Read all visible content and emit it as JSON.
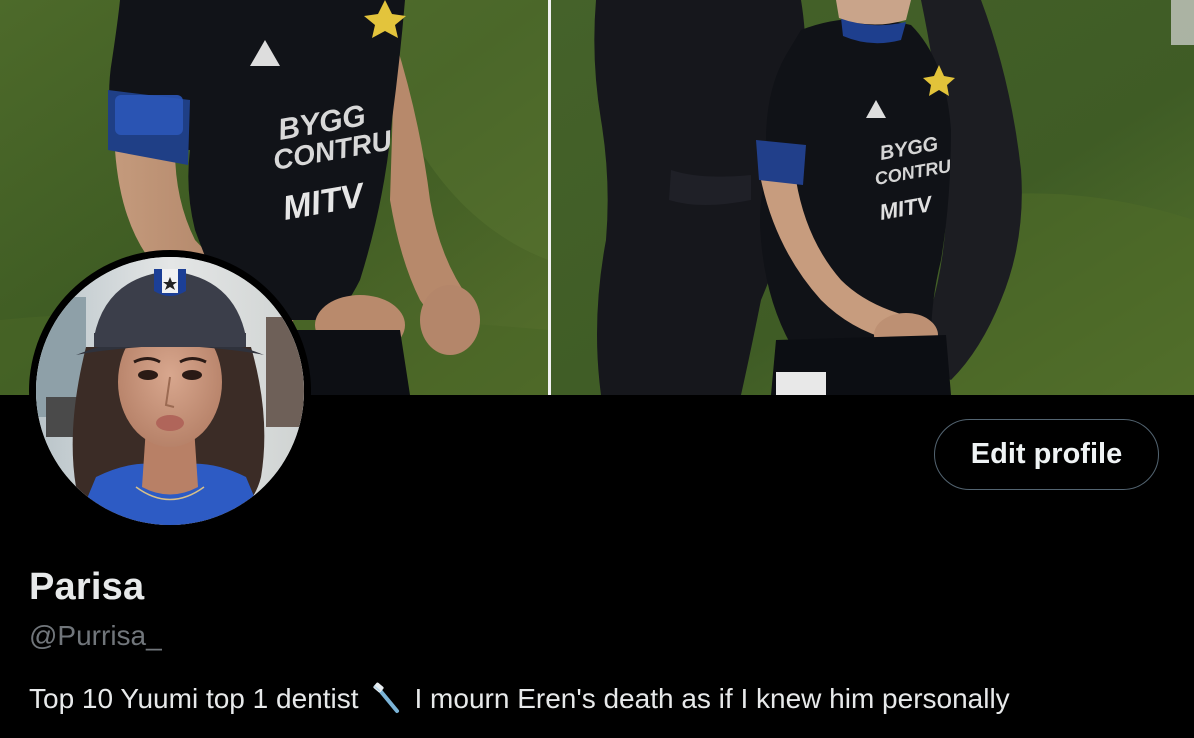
{
  "profile": {
    "display_name": "Parisa",
    "handle": "@Purrisa_",
    "bio_part1": "Top 10 Yuumi top 1 dentist",
    "bio_emoji": "toothbrush-icon",
    "bio_part2": "I mourn Eren's death as if I knew him personally"
  },
  "actions": {
    "edit_profile_label": "Edit profile"
  },
  "colors": {
    "background": "#000000",
    "text_primary": "#e7e9ea",
    "text_secondary": "#71767b",
    "button_border": "#536471"
  }
}
